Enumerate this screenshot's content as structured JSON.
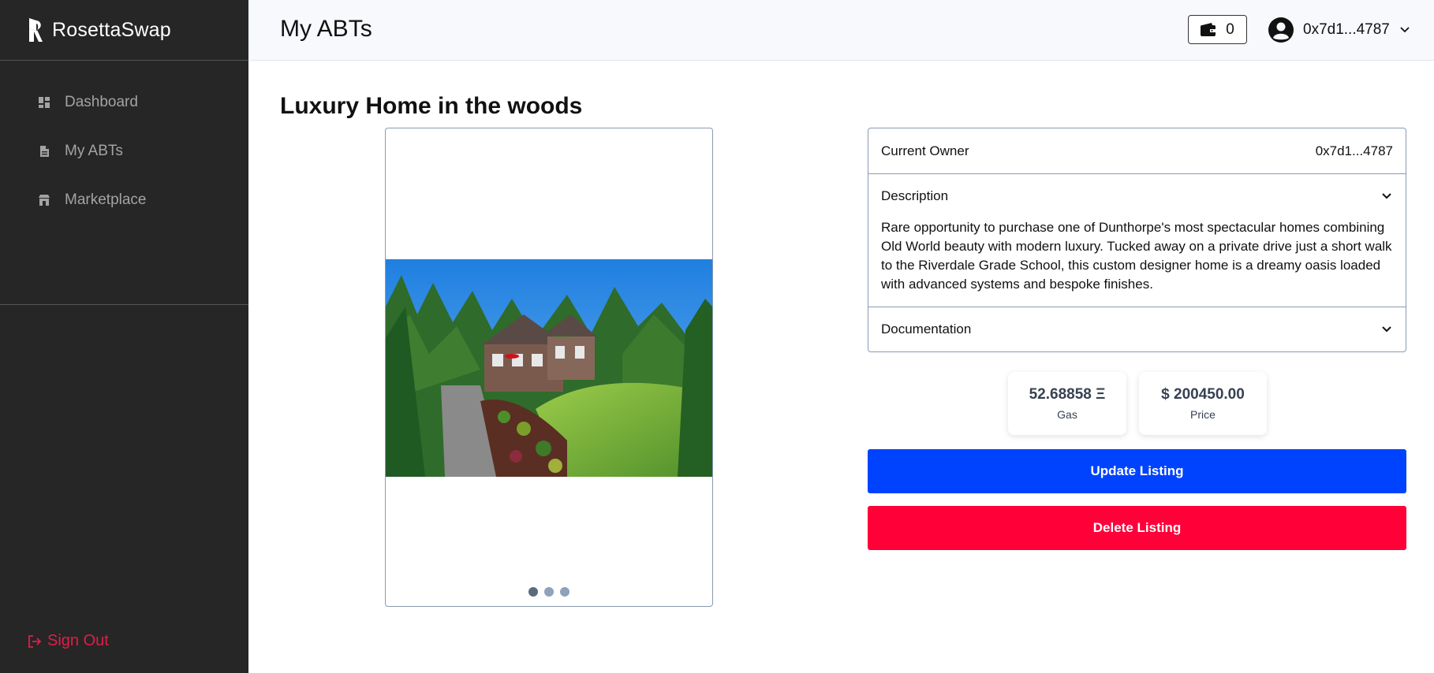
{
  "sidebar": {
    "brand": "RosettaSwap",
    "items": [
      {
        "label": "Dashboard",
        "icon": "dashboard-icon"
      },
      {
        "label": "My ABTs",
        "icon": "document-icon"
      },
      {
        "label": "Marketplace",
        "icon": "store-icon"
      }
    ],
    "signout_label": "Sign Out"
  },
  "header": {
    "title": "My ABTs",
    "wallet_count": "0",
    "account_address": "0x7d1...4787"
  },
  "listing": {
    "title": "Luxury Home in the woods",
    "carousel_slides": 3,
    "current_slide": 1,
    "current_owner_label": "Current Owner",
    "current_owner_value": "0x7d1...4787",
    "description_label": "Description",
    "description_text": "Rare opportunity to purchase one of Dunthorpe's most spectacular homes combining Old World beauty with modern luxury. Tucked away on a private drive just a short walk to the Riverdale Grade School, this custom designer home is a dreamy oasis loaded with advanced systems and bespoke finishes.",
    "documentation_label": "Documentation",
    "gas_value": "52.68858 Ξ",
    "gas_label": "Gas",
    "price_value": "$ 200450.00",
    "price_label": "Price",
    "update_label": "Update Listing",
    "delete_label": "Delete Listing"
  },
  "colors": {
    "sidebar_bg": "#262626",
    "update_button": "#0043ff",
    "delete_button": "#ff0038",
    "signout": "#e11d48"
  }
}
